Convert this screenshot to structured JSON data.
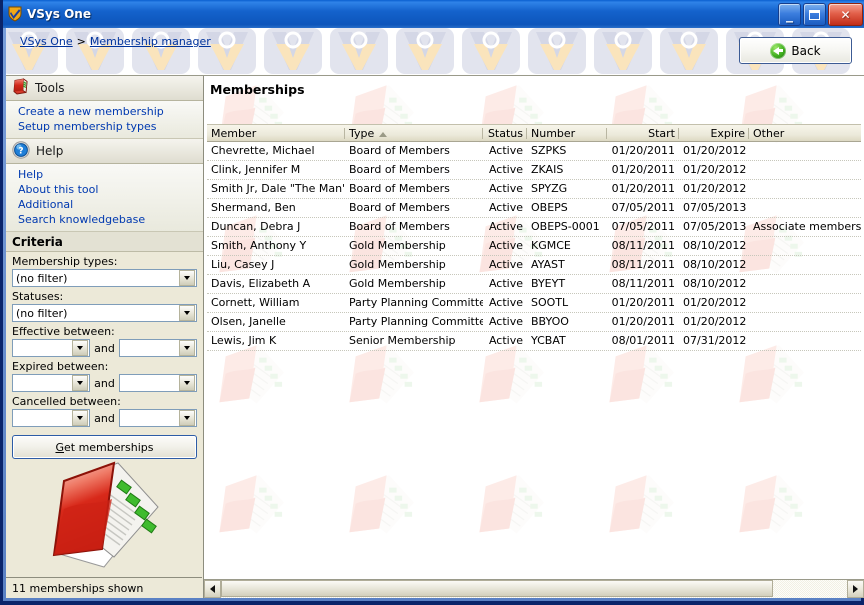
{
  "window": {
    "title": "VSys One",
    "icon": "shield-check-icon",
    "buttons": {
      "minimize": "_",
      "maximize": "▢",
      "close": "✕"
    }
  },
  "breadcrumb": {
    "root": "VSys One",
    "separator": ">",
    "current": "Membership manager"
  },
  "back_button": {
    "label": "Back",
    "icon": "back-arrow-icon"
  },
  "sidebar": {
    "tools": {
      "title": "Tools",
      "icon": "red-book-icon",
      "links": [
        "Create a new membership",
        "Setup membership types"
      ]
    },
    "help": {
      "title": "Help",
      "icon": "question-circle-icon",
      "links": [
        "Help",
        "About this tool",
        "Additional",
        "Search knowledgebase"
      ]
    },
    "criteria": {
      "title": "Criteria",
      "fields": [
        {
          "label": "Membership types:",
          "value": "(no filter)",
          "type": "combo"
        },
        {
          "label": "Statuses:",
          "value": "(no filter)",
          "type": "combo"
        },
        {
          "label": "Effective between:",
          "from": "",
          "to": "",
          "and": "and",
          "type": "range"
        },
        {
          "label": "Expired between:",
          "from": "",
          "to": "",
          "and": "and",
          "type": "range"
        },
        {
          "label": "Cancelled between:",
          "from": "",
          "to": "",
          "and": "and",
          "type": "range"
        }
      ],
      "get_button": {
        "accel": "G",
        "rest": "et memberships"
      }
    },
    "artwork_icon": "red-address-book-icon",
    "status": "11 memberships shown"
  },
  "main": {
    "title": "Memberships",
    "sort_column": "Type",
    "sort_direction": "asc",
    "columns": [
      {
        "key": "member",
        "label": "Member",
        "align": "left"
      },
      {
        "key": "type",
        "label": "Type",
        "align": "left"
      },
      {
        "key": "status",
        "label": "Status",
        "align": "right"
      },
      {
        "key": "number",
        "label": "Number",
        "align": "left"
      },
      {
        "key": "start",
        "label": "Start",
        "align": "right"
      },
      {
        "key": "expire",
        "label": "Expire",
        "align": "right"
      },
      {
        "key": "other",
        "label": "Other",
        "align": "left"
      }
    ],
    "rows": [
      {
        "member": "Chevrette, Michael",
        "type": "Board of Members",
        "status": "Active",
        "number": "SZPKS",
        "start": "01/20/2011",
        "expire": "01/20/2012",
        "other": ""
      },
      {
        "member": "Clink, Jennifer M",
        "type": "Board of Members",
        "status": "Active",
        "number": "ZKAIS",
        "start": "01/20/2011",
        "expire": "01/20/2012",
        "other": ""
      },
      {
        "member": "Smith Jr, Dale \"The Man\"",
        "type": "Board of Members",
        "status": "Active",
        "number": "SPYZG",
        "start": "01/20/2011",
        "expire": "01/20/2012",
        "other": ""
      },
      {
        "member": "Shermand, Ben",
        "type": "Board of Members",
        "status": "Active",
        "number": "OBEPS",
        "start": "07/05/2011",
        "expire": "07/05/2013",
        "other": ""
      },
      {
        "member": "Duncan, Debra J",
        "type": "Board of Members",
        "status": "Active",
        "number": "OBEPS-0001",
        "start": "07/05/2011",
        "expire": "07/05/2013",
        "other": "Associate membership"
      },
      {
        "member": "Smith, Anthony Y",
        "type": "Gold Membership",
        "status": "Active",
        "number": "KGMCE",
        "start": "08/11/2011",
        "expire": "08/10/2012",
        "other": ""
      },
      {
        "member": "Liu, Casey J",
        "type": "Gold Membership",
        "status": "Active",
        "number": "AYAST",
        "start": "08/11/2011",
        "expire": "08/10/2012",
        "other": ""
      },
      {
        "member": "Davis, Elizabeth A",
        "type": "Gold Membership",
        "status": "Active",
        "number": "BYEYT",
        "start": "08/11/2011",
        "expire": "08/10/2012",
        "other": ""
      },
      {
        "member": "Cornett, William",
        "type": "Party Planning Committee",
        "status": "Active",
        "number": "SOOTL",
        "start": "01/20/2011",
        "expire": "01/20/2012",
        "other": ""
      },
      {
        "member": "Olsen, Janelle",
        "type": "Party Planning Committee",
        "status": "Active",
        "number": "BBYOO",
        "start": "01/20/2011",
        "expire": "01/20/2012",
        "other": ""
      },
      {
        "member": "Lewis, Jim K",
        "type": "Senior Membership",
        "status": "Active",
        "number": "YCBAT",
        "start": "08/01/2011",
        "expire": "07/31/2012",
        "other": ""
      }
    ],
    "row_count": 11
  },
  "scrollbar": {
    "left_arrow": "◀",
    "right_arrow": "▶"
  },
  "colors": {
    "title_bar": "#1462cc",
    "link": "#0039b0",
    "panel": "#ece9d8",
    "grid_header": "#eceadb",
    "accent_red": "#cc2222",
    "accent_green": "#3fae1e"
  }
}
